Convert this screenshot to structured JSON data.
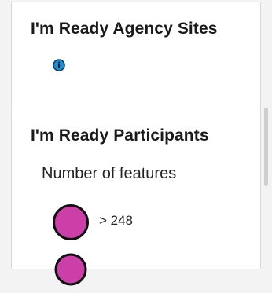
{
  "layers": [
    {
      "title": "I'm Ready Agency Sites",
      "icon": "info-icon"
    },
    {
      "title": "I'm Ready Participants",
      "field_label": "Number of features",
      "legend": [
        {
          "label": "> 248",
          "color": "#cc3fa9"
        },
        {
          "label": "",
          "color": "#cc3fa9"
        }
      ]
    }
  ],
  "colors": {
    "info_icon": "#1b8fd1",
    "symbol_fill": "#cc3fa9",
    "symbol_stroke": "#111111"
  }
}
